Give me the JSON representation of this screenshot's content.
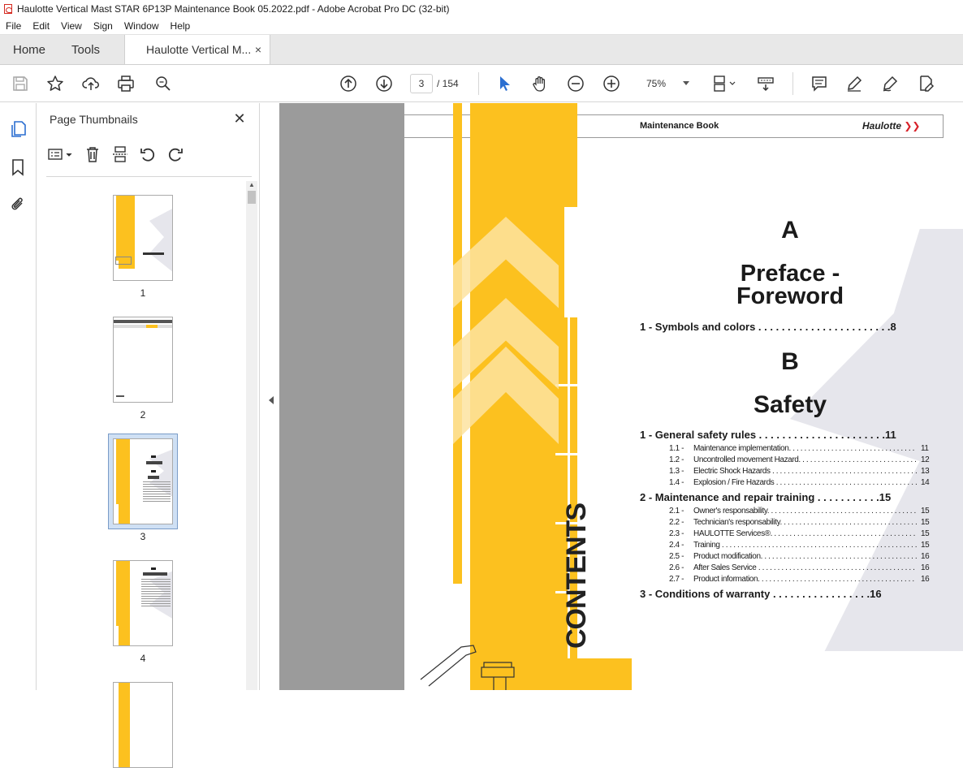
{
  "window": {
    "title": "Haulotte Vertical Mast STAR 6P13P Maintenance Book 05.2022.pdf - Adobe Acrobat Pro DC (32-bit)"
  },
  "menu": [
    "File",
    "Edit",
    "View",
    "Sign",
    "Window",
    "Help"
  ],
  "tabs": {
    "home": "Home",
    "tools": "Tools",
    "document": "Haulotte Vertical M...",
    "close": "×"
  },
  "toolbar": {
    "current_page": "3",
    "total_pages": "/ 154",
    "zoom": "75%"
  },
  "thumbnails": {
    "title": "Page Thumbnails",
    "close": "✕",
    "pages": [
      "1",
      "2",
      "3",
      "4"
    ],
    "selected_page": "3"
  },
  "document": {
    "header": "Maintenance Book",
    "brand": "Haulotte",
    "side_text": "CONTENTS",
    "section_a_letter": "A",
    "section_a_title_1": "Preface -",
    "section_a_title_2": "Foreword",
    "section_b_letter": "B",
    "section_b_title": "Safety",
    "toc": [
      {
        "level": 1,
        "text": "1 - Symbols and colors . . . . . . . . . . . . . . . . . . . . . . .8"
      },
      {
        "level": 1,
        "text": "1 - General safety rules . . . . . . . . . . . . . . . . . . . . . .11"
      },
      {
        "level": 2,
        "num": "1.1 -",
        "text": "Maintenance implementation. . . . . . . . . . . . . . . . . . . . . . . . . . . . . . . . . . . .",
        "page": "11"
      },
      {
        "level": 2,
        "num": "1.2 -",
        "text": "Uncontrolled movement Hazard. . . . . . . . . . . . . . . . . . . . . . . . . . . . . . . . .",
        "page": "12"
      },
      {
        "level": 2,
        "num": "1.3 -",
        "text": "Electric Shock Hazards . . . . . . . . . . . . . . . . . . . . . . . . . . . . . . . . . . . . . . . .",
        "page": "13"
      },
      {
        "level": 2,
        "num": "1.4 -",
        "text": "Explosion / Fire Hazards . . . . . . . . . . . . . . . . . . . . . . . . . . . . . . . . . . . . . .",
        "page": "14"
      },
      {
        "level": 1,
        "text": "2 - Maintenance and repair training . . . . . . . . . . .15"
      },
      {
        "level": 2,
        "num": "2.1 -",
        "text": "Owner's responsability. . . . . . . . . . . . . . . . . . . . . . . . . . . . . . . . . . . . . . . .",
        "page": "15"
      },
      {
        "level": 2,
        "num": "2.2 -",
        "text": "Technician's responsability. . . . . . . . . . . . . . . . . . . . . . . . . . . . . . . . . . . .",
        "page": "15"
      },
      {
        "level": 2,
        "num": "2.3 -",
        "text": "HAULOTTE Services®. . . . . . . . . . . . . . . . . . . . . . . . . . . . . . . . . . . . . . . . .",
        "page": "15"
      },
      {
        "level": 2,
        "num": "2.4 -",
        "text": "Training . . . . . . . . . . . . . . . . . . . . . . . . . . . . . . . . . . . . . . . . . . . . . . . . . . .",
        "page": "15"
      },
      {
        "level": 2,
        "num": "2.5 -",
        "text": "Product modification. . . . . . . . . . . . . . . . . . . . . . . . . . . . . . . . . . . . . . . . . .",
        "page": "16"
      },
      {
        "level": 2,
        "num": "2.6 -",
        "text": "After Sales Service . . . . . . . . . . . . . . . . . . . . . . . . . . . . . . . . . . . . . . . . . .",
        "page": "16"
      },
      {
        "level": 2,
        "num": "2.7 -",
        "text": "Product information. . . . . . . . . . . . . . . . . . . . . . . . . . . . . . . . . . . . . . . . . .",
        "page": "16"
      },
      {
        "level": 1,
        "text": "3 - Conditions of warranty  . . . . . . . . . . . . . . . . .16"
      }
    ]
  },
  "colors": {
    "accent_yellow": "#fcc11f",
    "light_yellow": "#fde3a0",
    "selection_blue": "#cfe0f4",
    "acrobat_blue": "#2c6fd1",
    "brand_red": "#d8222a"
  }
}
